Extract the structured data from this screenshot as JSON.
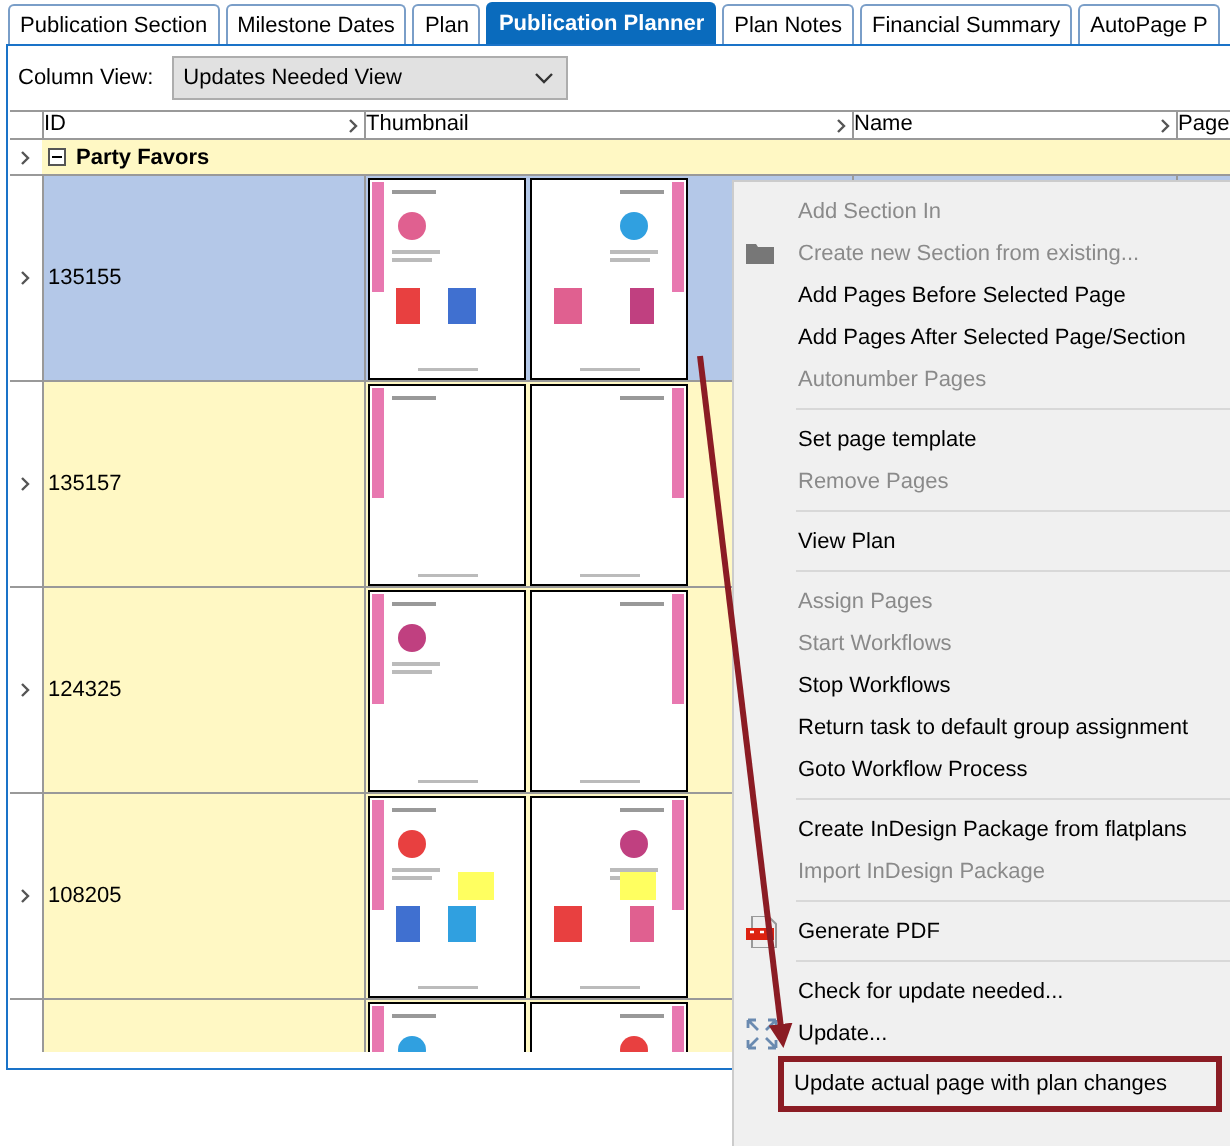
{
  "tabs": [
    {
      "label": "Publication Section",
      "selected": false
    },
    {
      "label": "Milestone Dates",
      "selected": false
    },
    {
      "label": "Plan",
      "selected": false
    },
    {
      "label": "Publication Planner",
      "selected": true
    },
    {
      "label": "Plan Notes",
      "selected": false
    },
    {
      "label": "Financial Summary",
      "selected": false
    },
    {
      "label": "AutoPage P",
      "selected": false
    }
  ],
  "column_view": {
    "label": "Column View:",
    "value": "Updates Needed View"
  },
  "grid": {
    "columns": [
      "ID",
      "Thumbnail",
      "Name",
      "Page"
    ],
    "group": {
      "label": "Party Favors",
      "expanded": true
    },
    "rows": [
      {
        "id": "135155",
        "selected": true
      },
      {
        "id": "135157",
        "selected": false
      },
      {
        "id": "124325",
        "selected": false
      },
      {
        "id": "108205",
        "selected": false
      },
      {
        "selected": false
      }
    ]
  },
  "context_menu": {
    "items": [
      {
        "kind": "item",
        "label": "Add Section In",
        "disabled": true,
        "outlined": false
      },
      {
        "kind": "folder",
        "label": "Create new Section from existing...",
        "disabled": true,
        "outlined": false
      },
      {
        "kind": "item",
        "label": "Add Pages Before Selected Page",
        "disabled": false,
        "outlined": false
      },
      {
        "kind": "item",
        "label": "Add Pages After Selected Page/Section",
        "disabled": false,
        "outlined": false
      },
      {
        "kind": "item",
        "label": "Autonumber Pages",
        "disabled": true,
        "outlined": false
      },
      {
        "kind": "separator"
      },
      {
        "kind": "item",
        "label": "Set page template",
        "disabled": false,
        "outlined": false
      },
      {
        "kind": "item",
        "label": "Remove Pages",
        "disabled": true,
        "outlined": false
      },
      {
        "kind": "separator"
      },
      {
        "kind": "item",
        "label": "View Plan",
        "disabled": false,
        "outlined": false
      },
      {
        "kind": "separator"
      },
      {
        "kind": "item",
        "label": "Assign Pages",
        "disabled": true,
        "outlined": false
      },
      {
        "kind": "item",
        "label": "Start Workflows",
        "disabled": true,
        "outlined": false
      },
      {
        "kind": "item",
        "label": "Stop Workflows",
        "disabled": false,
        "outlined": false
      },
      {
        "kind": "item",
        "label": "Return task to default group assignment",
        "disabled": false,
        "outlined": false
      },
      {
        "kind": "item",
        "label": "Goto Workflow Process",
        "disabled": false,
        "outlined": false
      },
      {
        "kind": "separator"
      },
      {
        "kind": "item",
        "label": "Create InDesign Package from flatplans",
        "disabled": false,
        "outlined": false
      },
      {
        "kind": "item",
        "label": "Import InDesign Package",
        "disabled": true,
        "outlined": false
      },
      {
        "kind": "separator"
      },
      {
        "kind": "pdf",
        "label": "Generate PDF",
        "disabled": false,
        "outlined": false
      },
      {
        "kind": "separator"
      },
      {
        "kind": "item",
        "label": "Check for update needed...",
        "disabled": false,
        "outlined": false
      },
      {
        "kind": "update",
        "label": "Update...",
        "disabled": false,
        "outlined": false
      },
      {
        "kind": "item",
        "label": "Update actual page with plan changes",
        "disabled": false,
        "outlined": true
      }
    ]
  }
}
